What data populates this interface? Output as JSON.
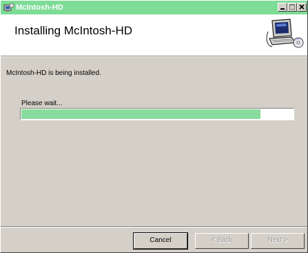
{
  "window": {
    "title": "McIntosh-HD",
    "colors": {
      "titlebar": "#7ddc96",
      "face": "#d4d0c8",
      "progress": "#88dc9d"
    },
    "controls": {
      "minimize_icon": "minimize-icon",
      "maximize_icon": "maximize-icon",
      "close_icon": "close-icon"
    }
  },
  "banner": {
    "title": "Installing McIntosh-HD",
    "graphic_icon": "computer-installer-icon"
  },
  "body": {
    "status": "McIntosh-HD is being installed.",
    "wait_label": "Please wait...",
    "progress_fraction": 0.88
  },
  "buttons": {
    "cancel": "Cancel",
    "back": "< Back",
    "next": "Next >"
  }
}
